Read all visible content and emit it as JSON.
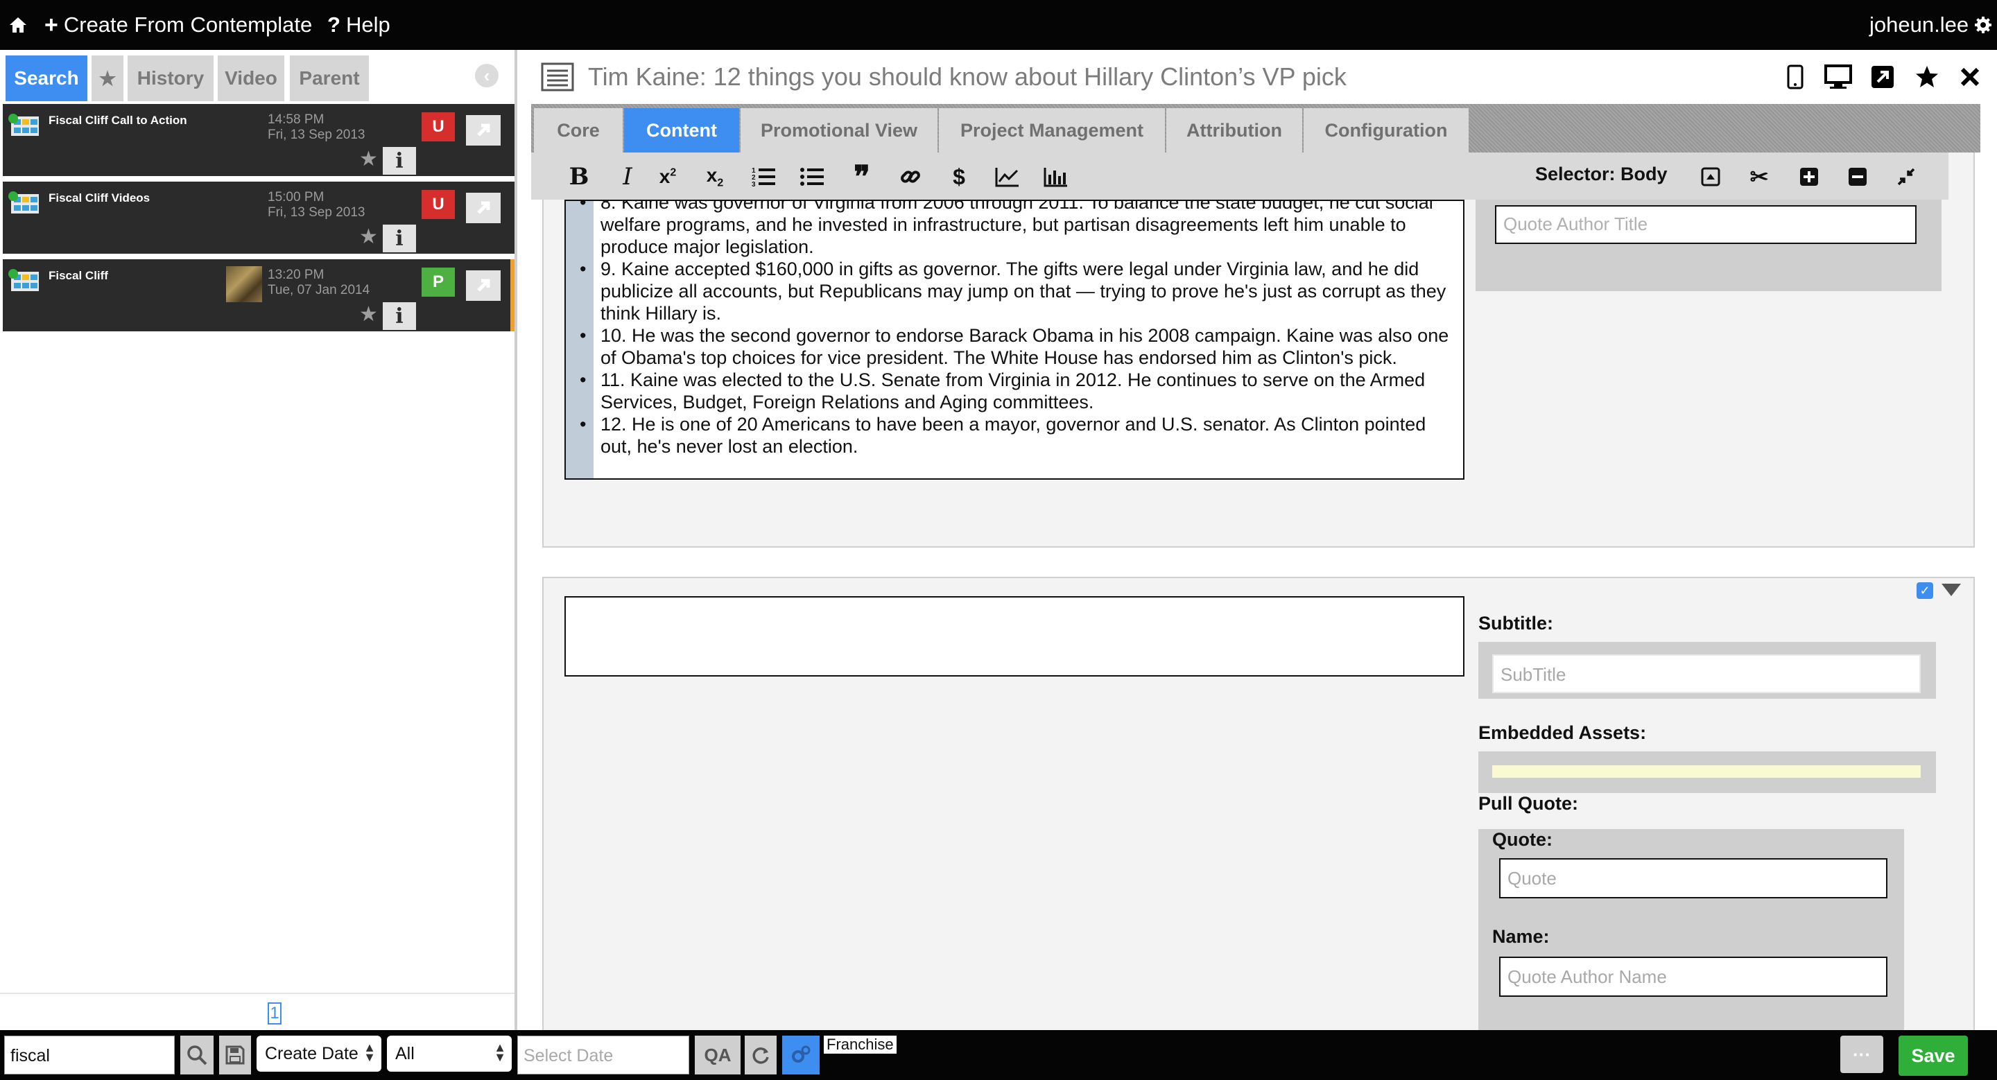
{
  "topbar": {
    "create_label": "Create From Contemplate",
    "help_label": "Help",
    "username": "joheun.lee"
  },
  "left": {
    "tabs": [
      {
        "label": "Search"
      },
      {
        "label": "★"
      },
      {
        "label": "History"
      },
      {
        "label": "Video"
      },
      {
        "label": "Parent"
      }
    ],
    "results": [
      {
        "title": "Fiscal Cliff Call to Action",
        "time": "14:58 PM",
        "date": "Fri, 13 Sep 2013",
        "badge": "U",
        "badge_color": "#d62d2d"
      },
      {
        "title": "Fiscal Cliff Videos",
        "time": "15:00 PM",
        "date": "Fri, 13 Sep 2013",
        "badge": "U",
        "badge_color": "#d62d2d"
      },
      {
        "title": "Fiscal Cliff",
        "time": "13:20 PM",
        "date": "Tue, 07 Jan 2014",
        "badge": "P",
        "badge_color": "#4cb140"
      }
    ],
    "page": "1"
  },
  "main": {
    "title": "Tim Kaine: 12 things you should know about Hillary Clinton’s VP pick",
    "tabs": [
      {
        "label": "Core"
      },
      {
        "label": "Content"
      },
      {
        "label": "Promotional View"
      },
      {
        "label": "Project Management"
      },
      {
        "label": "Attribution"
      },
      {
        "label": "Configuration"
      }
    ],
    "selector_label": "Selector: Body",
    "body_items": [
      "8. Kaine was governor of Virginia from 2006 through 2011. To balance the state budget, he cut social welfare programs, and he invested in infrastructure, but partisan disagreements left him unable to produce major legislation.",
      "9. Kaine accepted $160,000 in gifts as governor. The gifts were legal under Virginia law, and he did publicize all accounts, but Republicans may jump on that — trying to prove he's just as corrupt as they think Hillary is.",
      "10. He was the second governor to endorse Barack Obama in his 2008 campaign. Kaine was also one of Obama's top choices for vice president. The White House has endorsed him as Clinton's pick.",
      "11. Kaine was elected to the U.S. Senate from Virginia in 2012. He continues to serve on the Armed Services, Budget, Foreign Relations and Aging committees.",
      "12. He is one of 20 Americans to have been a mayor, governor and U.S. senator. As Clinton pointed out, he's never lost an election."
    ],
    "quote_author_title_placeholder": "Quote Author Title",
    "subtitle_label": "Subtitle:",
    "subtitle_placeholder": "SubTitle",
    "embedded_label": "Embedded Assets:",
    "pull_quote_label": "Pull Quote:",
    "quote_label": "Quote:",
    "quote_placeholder": "Quote",
    "name_label": "Name:",
    "name_placeholder": "Quote Author Name"
  },
  "bottom": {
    "search_value": "fiscal",
    "sort_value": "Create Date",
    "filter_value": "All",
    "date_placeholder": "Select Date",
    "franchise_label": "Franchise",
    "save_label": "Save",
    "more_label": "···"
  },
  "colors": {
    "accent": "#3d8ef0",
    "save": "#2fae3a",
    "badge_u": "#d62d2d",
    "badge_p": "#4cb140"
  }
}
